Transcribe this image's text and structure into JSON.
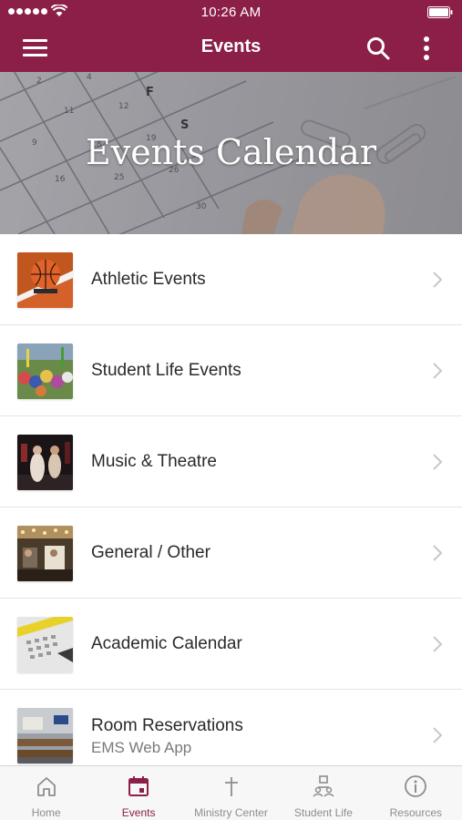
{
  "status_bar": {
    "time": "10:26 AM"
  },
  "app_bar": {
    "title": "Events"
  },
  "hero": {
    "title": "Events Calendar"
  },
  "list": {
    "items": [
      {
        "title": "Athletic Events",
        "subtitle": ""
      },
      {
        "title": "Student Life Events",
        "subtitle": ""
      },
      {
        "title": "Music & Theatre",
        "subtitle": ""
      },
      {
        "title": "General / Other",
        "subtitle": ""
      },
      {
        "title": "Academic Calendar",
        "subtitle": ""
      },
      {
        "title": "Room Reservations",
        "subtitle": "EMS Web App"
      }
    ]
  },
  "tabs": [
    {
      "label": "Home",
      "icon": "home-icon",
      "active": false
    },
    {
      "label": "Events",
      "icon": "calendar-icon",
      "active": true
    },
    {
      "label": "Ministry Center",
      "icon": "cross-icon",
      "active": false
    },
    {
      "label": "Student Life",
      "icon": "people-icon",
      "active": false
    },
    {
      "label": "Resources",
      "icon": "info-icon",
      "active": false
    }
  ],
  "colors": {
    "brand": "#8b1f47",
    "tab_inactive": "#8d8d8d",
    "divider": "#e4e4e4"
  }
}
